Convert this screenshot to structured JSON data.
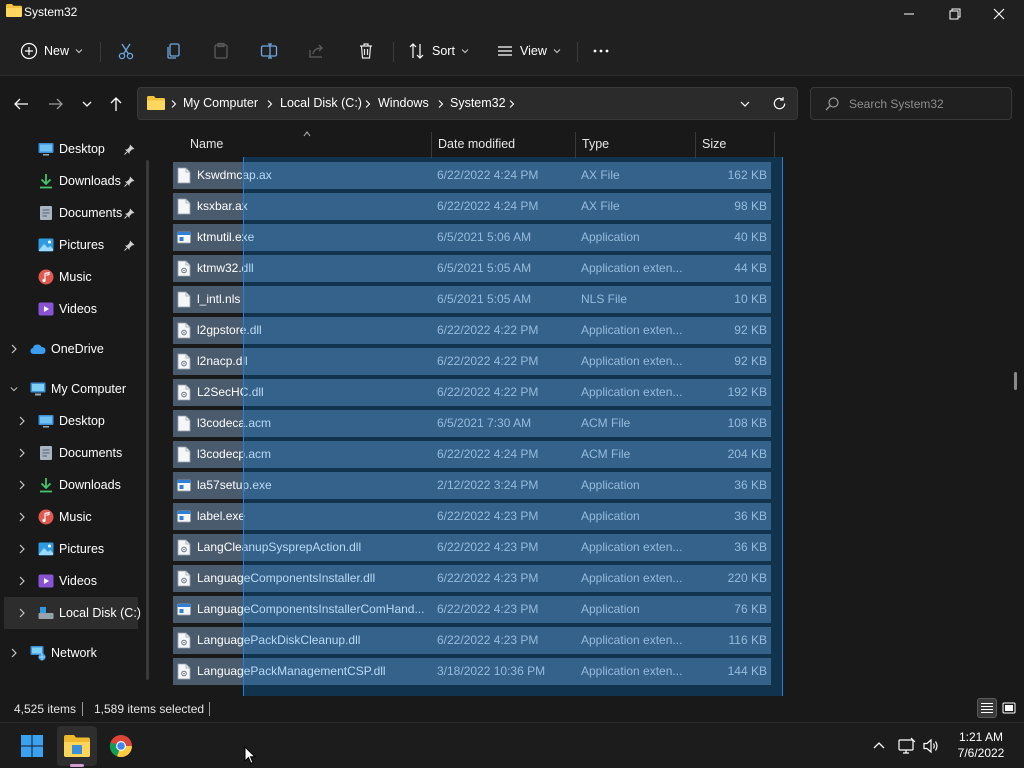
{
  "window": {
    "title": "System32",
    "colors": {
      "accent": "#0078d7",
      "selection_row": "#4a5b6e",
      "background": "#191919"
    }
  },
  "commandbar": {
    "new_label": "New",
    "sort_label": "Sort",
    "view_label": "View",
    "icons": [
      "plus-circle-icon",
      "cut-icon",
      "copy-icon",
      "paste-icon",
      "rename-icon",
      "share-icon",
      "delete-icon",
      "sort-icon",
      "view-icon",
      "more-icon"
    ]
  },
  "address": {
    "crumbs": [
      "My Computer",
      "Local Disk (C:)",
      "Windows",
      "System32"
    ],
    "search_placeholder": "Search System32"
  },
  "navpane": {
    "quick_access": [
      {
        "label": "Desktop",
        "icon": "desktop-icon"
      },
      {
        "label": "Downloads",
        "icon": "download-icon"
      },
      {
        "label": "Documents",
        "icon": "document-icon"
      },
      {
        "label": "Pictures",
        "icon": "pictures-icon"
      },
      {
        "label": "Music",
        "icon": "music-icon"
      },
      {
        "label": "Videos",
        "icon": "videos-icon"
      }
    ],
    "onedrive": "OneDrive",
    "my_computer": "My Computer",
    "computer_children": [
      {
        "label": "Desktop",
        "icon": "desktop-icon"
      },
      {
        "label": "Documents",
        "icon": "document-icon"
      },
      {
        "label": "Downloads",
        "icon": "download-icon"
      },
      {
        "label": "Music",
        "icon": "music-icon"
      },
      {
        "label": "Pictures",
        "icon": "pictures-icon"
      },
      {
        "label": "Videos",
        "icon": "videos-icon"
      },
      {
        "label": "Local Disk (C:)",
        "icon": "drive-icon"
      }
    ],
    "network": "Network"
  },
  "columns": {
    "name": "Name",
    "date": "Date modified",
    "type": "Type",
    "size": "Size"
  },
  "files": [
    {
      "name": "Kswdmcap.ax",
      "date": "6/22/2022 4:24 PM",
      "type": "AX File",
      "size": "162 KB",
      "kind": "file"
    },
    {
      "name": "ksxbar.ax",
      "date": "6/22/2022 4:24 PM",
      "type": "AX File",
      "size": "98 KB",
      "kind": "file"
    },
    {
      "name": "ktmutil.exe",
      "date": "6/5/2021 5:06 AM",
      "type": "Application",
      "size": "40 KB",
      "kind": "exe"
    },
    {
      "name": "ktmw32.dll",
      "date": "6/5/2021 5:05 AM",
      "type": "Application exten...",
      "size": "44 KB",
      "kind": "dll"
    },
    {
      "name": "l_intl.nls",
      "date": "6/5/2021 5:05 AM",
      "type": "NLS File",
      "size": "10 KB",
      "kind": "file"
    },
    {
      "name": "l2gpstore.dll",
      "date": "6/22/2022 4:22 PM",
      "type": "Application exten...",
      "size": "92 KB",
      "kind": "dll"
    },
    {
      "name": "l2nacp.dll",
      "date": "6/22/2022 4:22 PM",
      "type": "Application exten...",
      "size": "92 KB",
      "kind": "dll"
    },
    {
      "name": "L2SecHC.dll",
      "date": "6/22/2022 4:22 PM",
      "type": "Application exten...",
      "size": "192 KB",
      "kind": "dll"
    },
    {
      "name": "l3codeca.acm",
      "date": "6/5/2021 7:30 AM",
      "type": "ACM File",
      "size": "108 KB",
      "kind": "file"
    },
    {
      "name": "l3codecp.acm",
      "date": "6/22/2022 4:24 PM",
      "type": "ACM File",
      "size": "204 KB",
      "kind": "file"
    },
    {
      "name": "la57setup.exe",
      "date": "2/12/2022 3:24 PM",
      "type": "Application",
      "size": "36 KB",
      "kind": "exe"
    },
    {
      "name": "label.exe",
      "date": "6/22/2022 4:23 PM",
      "type": "Application",
      "size": "36 KB",
      "kind": "exe"
    },
    {
      "name": "LangCleanupSysprepAction.dll",
      "date": "6/22/2022 4:23 PM",
      "type": "Application exten...",
      "size": "36 KB",
      "kind": "dll"
    },
    {
      "name": "LanguageComponentsInstaller.dll",
      "date": "6/22/2022 4:23 PM",
      "type": "Application exten...",
      "size": "220 KB",
      "kind": "dll"
    },
    {
      "name": "LanguageComponentsInstallerComHand...",
      "date": "6/22/2022 4:23 PM",
      "type": "Application",
      "size": "76 KB",
      "kind": "exe"
    },
    {
      "name": "LanguagePackDiskCleanup.dll",
      "date": "6/22/2022 4:23 PM",
      "type": "Application exten...",
      "size": "116 KB",
      "kind": "dll"
    },
    {
      "name": "LanguagePackManagementCSP.dll",
      "date": "3/18/2022 10:36 PM",
      "type": "Application exten...",
      "size": "144 KB",
      "kind": "dll"
    }
  ],
  "status": {
    "items": "4,525 items",
    "selected": "1,589 items selected"
  },
  "taskbar": {
    "apps": [
      "windows-start-icon",
      "file-explorer-icon",
      "chrome-icon"
    ],
    "time": "1:21 AM",
    "date": "7/6/2022"
  }
}
